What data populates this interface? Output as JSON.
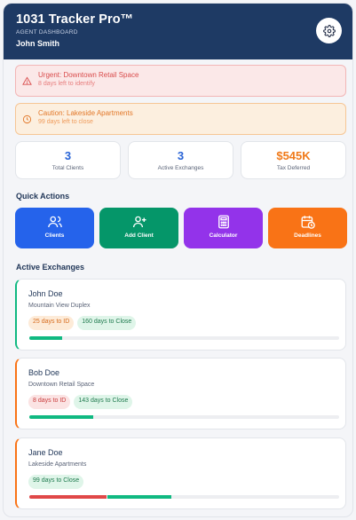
{
  "header": {
    "title": "1031 Tracker Pro™",
    "subtitle": "AGENT DASHBOARD",
    "user": "John Smith"
  },
  "alerts": [
    {
      "title": "Urgent: Downtown Retail Space",
      "detail": "8 days left to identify",
      "icon": "warning-triangle-icon"
    },
    {
      "title": "Caution: Lakeside Apartments",
      "detail": "99 days left to close",
      "icon": "clock-icon"
    }
  ],
  "stats": [
    {
      "value": "3",
      "label": "Total Clients"
    },
    {
      "value": "3",
      "label": "Active Exchanges"
    },
    {
      "value": "$545K",
      "label": "Tax Deferred"
    }
  ],
  "quick_actions": {
    "title": "Quick Actions",
    "items": [
      {
        "label": "Clients",
        "icon": "users-icon",
        "color": "#2563eb"
      },
      {
        "label": "Add Client",
        "icon": "user-plus-icon",
        "color": "#059669"
      },
      {
        "label": "Calculator",
        "icon": "calculator-icon",
        "color": "#9333ea"
      },
      {
        "label": "Deadlines",
        "icon": "calendar-clock-icon",
        "color": "#f97316"
      }
    ]
  },
  "exchanges": {
    "title": "Active Exchanges",
    "items": [
      {
        "name": "John Doe",
        "property": "Mountain View Duplex",
        "accent": "#10b981",
        "pills": [
          {
            "text": "25 days to ID",
            "tone": "orange"
          },
          {
            "text": "160 days to Close",
            "tone": "green"
          }
        ],
        "progress": {
          "identification_pct": 10.7,
          "close_pct": 0
        }
      },
      {
        "name": "Bob Doe",
        "property": "Downtown Retail Space",
        "accent": "#f97316",
        "pills": [
          {
            "text": "8 days to ID",
            "tone": "red"
          },
          {
            "text": "143 days to Close",
            "tone": "green"
          }
        ],
        "progress": {
          "identification_pct": 20.5,
          "close_pct": 0
        }
      },
      {
        "name": "Jane Doe",
        "property": "Lakeside Apartments",
        "accent": "#f97316",
        "pills": [
          {
            "text": "99 days to Close",
            "tone": "green"
          }
        ],
        "progress": {
          "identification_pct": 25,
          "close_pct": 20.5
        }
      }
    ]
  }
}
